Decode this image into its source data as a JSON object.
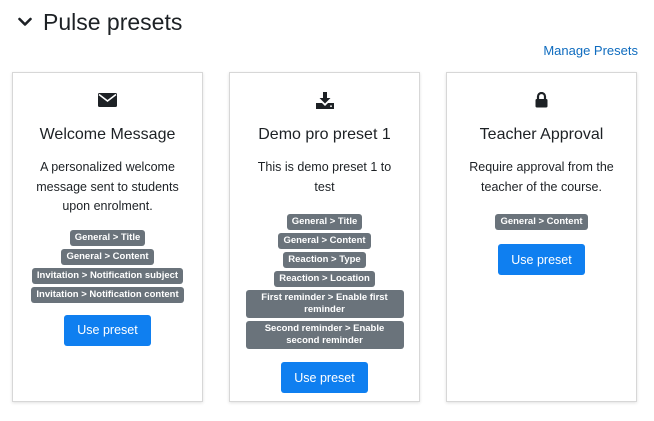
{
  "header": {
    "title": "Pulse presets",
    "manage_link": "Manage Presets"
  },
  "cards": [
    {
      "icon": "envelope-icon",
      "title": "Welcome Message",
      "description": "A personalized welcome message sent to students upon enrolment.",
      "badges": [
        "General > Title",
        "General > Content",
        "Invitation > Notification subject",
        "Invitation > Notification content"
      ],
      "button": "Use preset"
    },
    {
      "icon": "download-icon",
      "title": "Demo pro preset 1",
      "description": "This is demo preset 1 to test",
      "badges": [
        "General > Title",
        "General > Content",
        "Reaction > Type",
        "Reaction > Location",
        "First reminder > Enable first reminder",
        "Second reminder > Enable second reminder"
      ],
      "button": "Use preset"
    },
    {
      "icon": "lock-icon",
      "title": "Teacher Approval",
      "description": "Require approval from the teacher of the course.",
      "badges": [
        "General > Content"
      ],
      "button": "Use preset"
    }
  ],
  "colors": {
    "accent": "#0f7ff0",
    "link": "#0f6cbf",
    "badge": "#6a737b"
  }
}
